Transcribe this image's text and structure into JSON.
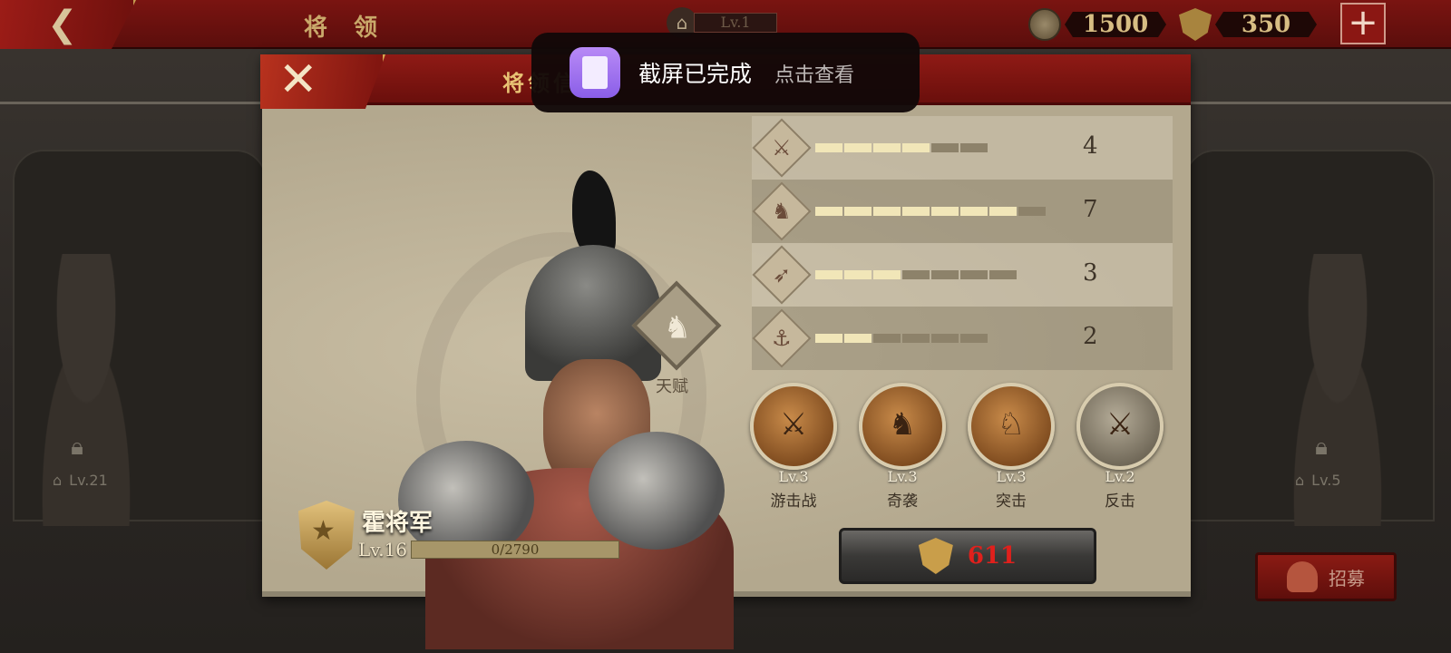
{
  "top_bar": {
    "title": "将 领",
    "city_level": "Lv.1",
    "coins": "1500",
    "honor": "350"
  },
  "background": {
    "left_locked_level": "Lv.21",
    "right_locked_level": "Lv.5",
    "recruit_label": "招募"
  },
  "modal": {
    "title": "将领信",
    "general": {
      "name": "霍将军",
      "level": "Lv.16",
      "exp": "0/2790"
    },
    "talent_label": "天赋",
    "stats": [
      {
        "icon": "sword-icon",
        "value": "4",
        "filled": 4,
        "total": 6
      },
      {
        "icon": "horse-icon",
        "value": "7",
        "filled": 7,
        "total": 8
      },
      {
        "icon": "bow-icon",
        "value": "3",
        "filled": 3,
        "total": 7
      },
      {
        "icon": "anchor-icon",
        "value": "2",
        "filled": 2,
        "total": 6
      }
    ],
    "skills": [
      {
        "level": "Lv.3",
        "name": "游击战"
      },
      {
        "level": "Lv.3",
        "name": "奇袭"
      },
      {
        "level": "Lv.3",
        "name": "突击"
      },
      {
        "level": "Lv.2",
        "name": "反击"
      }
    ],
    "cost": "611"
  },
  "toast": {
    "message": "截屏已完成",
    "action": "点击查看"
  },
  "colors": {
    "accent_red": "#8f1a15",
    "gold": "#e8c274",
    "cost_red": "#e0201c",
    "parchment": "#b8ad94"
  }
}
